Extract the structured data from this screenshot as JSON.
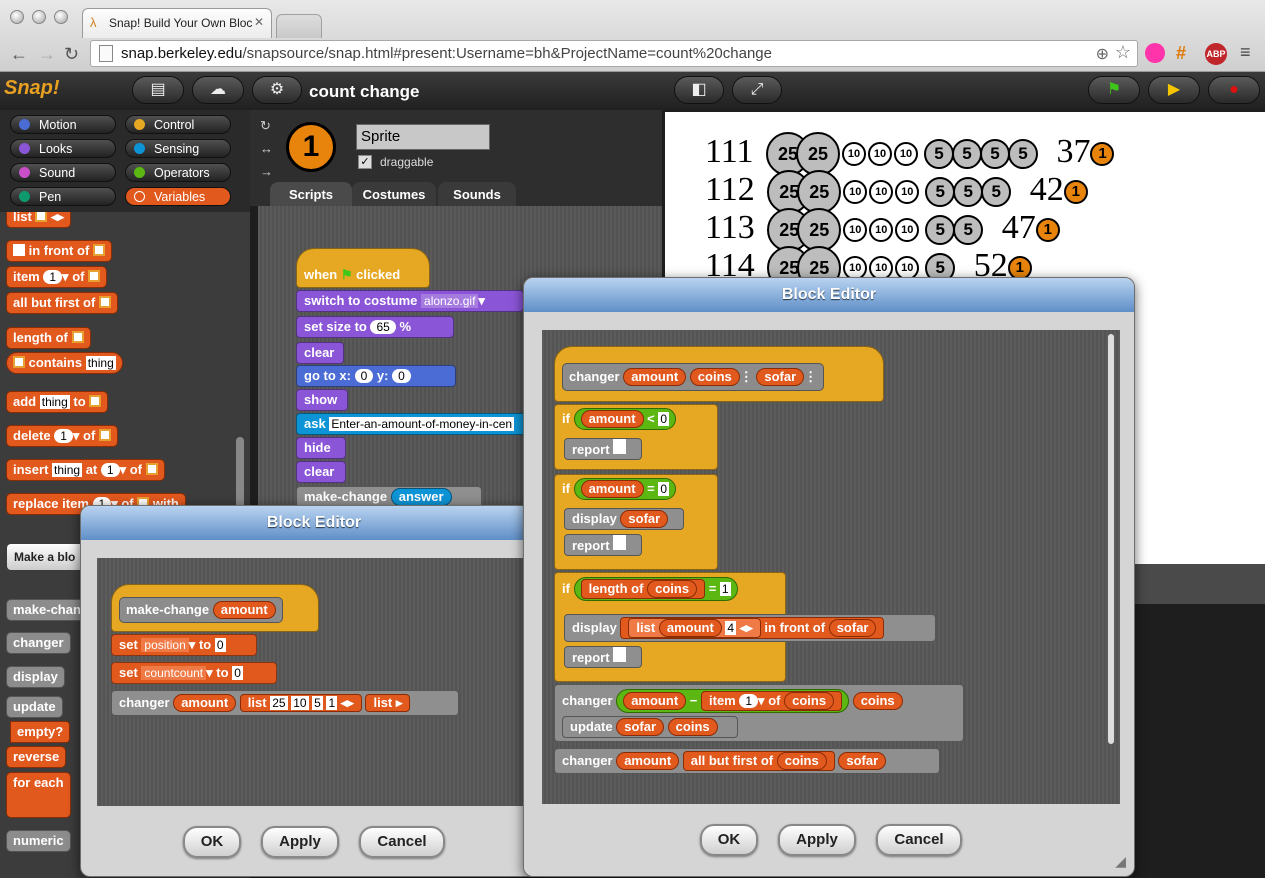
{
  "browser": {
    "tab_title": "Snap! Build Your Own Bloc",
    "url_host": "snap.berkeley.edu",
    "url_path": "/snapsource/snap.html#present:Username=bh&ProjectName=count%20change"
  },
  "app": {
    "logo": "Snap!",
    "project_name": "count change"
  },
  "categories": [
    "Motion",
    "Control",
    "Looks",
    "Sensing",
    "Sound",
    "Operators",
    "Pen",
    "Variables"
  ],
  "palette": {
    "list": "list",
    "in_front_of": "in front of",
    "item": "item",
    "item_idx": "1",
    "of": "of",
    "all_but_first": "all but first of",
    "length": "length of",
    "contains": "contains",
    "thing": "thing",
    "add": "add",
    "to": "to",
    "delete": "delete",
    "insert": "insert",
    "at": "at",
    "replace": "replace item",
    "with": "with",
    "make_block": "Make a blo",
    "custom": [
      "make-chang",
      "changer",
      "display",
      "update",
      "empty?",
      "reverse",
      "for each",
      "numeric"
    ]
  },
  "sprite": {
    "name": "Sprite",
    "draggable": "draggable",
    "tabs": [
      "Scripts",
      "Costumes",
      "Sounds"
    ],
    "costume_num": "1"
  },
  "script": {
    "when": "when",
    "clicked": "clicked",
    "switch_costume": "switch to costume",
    "costume": "alonzo.gif",
    "set_size": "set size to",
    "size": "65",
    "pct": "%",
    "clear": "clear",
    "goto": "go to x:",
    "x": "0",
    "y_lbl": "y:",
    "y": "0",
    "show": "show",
    "ask": "ask",
    "ask_text": "Enter-an-amount-of-money-in-cen",
    "hide": "hide",
    "clear2": "clear",
    "make_change": "make-change",
    "answer": "answer"
  },
  "stage": {
    "rows": [
      {
        "num": "111",
        "quarters": 2,
        "dimes": 3,
        "nickels": 4,
        "total": "37",
        "penny": "1"
      },
      {
        "num": "112",
        "quarters": 2,
        "dimes": 3,
        "nickels": 3,
        "total": "42",
        "penny": "1"
      },
      {
        "num": "113",
        "quarters": 2,
        "dimes": 3,
        "nickels": 2,
        "total": "47",
        "penny": "1"
      },
      {
        "num": "114",
        "quarters": 2,
        "dimes": 3,
        "nickels": 1,
        "total": "52",
        "penny": "1"
      }
    ],
    "quarter": "25",
    "dime": "10",
    "nickel": "5"
  },
  "editor_small": {
    "title": "Block Editor",
    "hat": "make-change",
    "param": "amount",
    "set": "set",
    "v1": "position",
    "to": "to",
    "n1": "0",
    "v2": "countcount",
    "n2": "0",
    "changer": "changer",
    "amount": "amount",
    "list": "list",
    "items": [
      "25",
      "10",
      "5",
      "1"
    ],
    "list2": "list",
    "ok": "OK",
    "apply": "Apply",
    "cancel": "Cancel"
  },
  "editor_big": {
    "title": "Block Editor",
    "hat": "changer",
    "p1": "amount",
    "p2": "coins",
    "p3": "sofar",
    "if": "if",
    "lt": "<",
    "zero": "0",
    "report": "report",
    "eq": "=",
    "display": "display",
    "sofar": "sofar",
    "length_of": "length of",
    "coins": "coins",
    "one": "1",
    "list": "list",
    "four": "4",
    "in_front_of": "in front of",
    "changer": "changer",
    "amount": "amount",
    "minus": "−",
    "item": "item",
    "of": "of",
    "update": "update",
    "all_but_first": "all but first of",
    "ok": "OK",
    "apply": "Apply",
    "cancel": "Cancel"
  },
  "colors": {
    "motion": "#4a6cd4",
    "looks": "#8a55d7",
    "control": "#e6a822",
    "sensing": "#0d94d6",
    "operators": "#5cb712",
    "variables": "#e2591e",
    "sound": "#c94fc9",
    "pen": "#0e9a6c"
  }
}
